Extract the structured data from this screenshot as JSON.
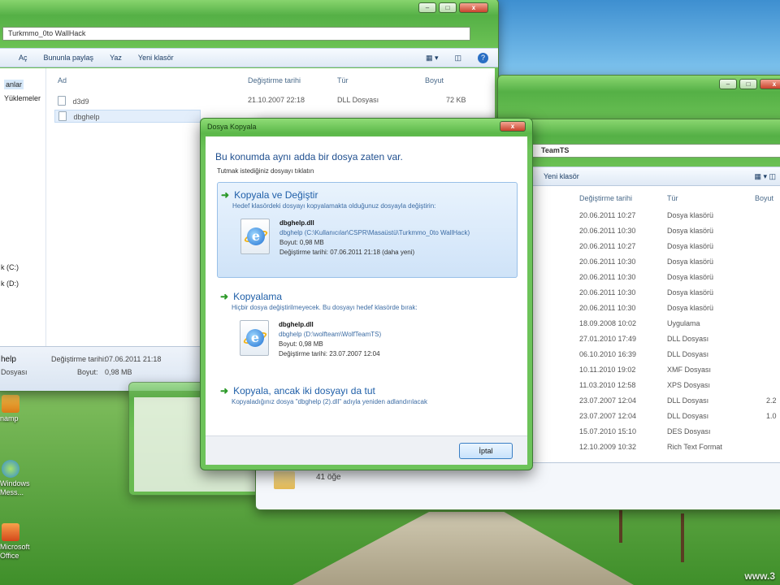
{
  "desktop": {
    "icons": [
      "namp",
      "Windows Mess...",
      "Microsoft Office"
    ],
    "watermark": "www.3"
  },
  "back_window": {
    "breadcrumb": "Turkmmo_0to WallHack",
    "toolbar": [
      "Aç",
      "Bununla paylaş",
      "Yaz",
      "Yeni klasör"
    ],
    "nav": [
      "anlar",
      "Yüklemeler",
      "k (C:)",
      "k (D:)"
    ],
    "columns": [
      "Ad",
      "Değiştirme tarihi",
      "Tür",
      "Boyut"
    ],
    "files": [
      {
        "name": "d3d9",
        "date": "21.10.2007 22:18",
        "type": "DLL Dosyası",
        "size": "72 KB"
      },
      {
        "name": "dbghelp",
        "date": "",
        "type": "",
        "size": ""
      }
    ],
    "details": {
      "name": "help",
      "type": "Dosyası",
      "date_label": "Değiştirme tarihi:",
      "date": "07.06.2011 21:18",
      "size_label": "Boyut:",
      "size": "0,98 MB"
    }
  },
  "right_window": {
    "breadcrumb": "TeamTS",
    "toolbar": [
      "Yeni klasör"
    ],
    "columns": [
      "Değiştirme tarihi",
      "Tür",
      "Boyut"
    ],
    "rows": [
      {
        "date": "20.06.2011 10:27",
        "type": "Dosya klasörü",
        "size": ""
      },
      {
        "date": "20.06.2011 10:30",
        "type": "Dosya klasörü",
        "size": ""
      },
      {
        "date": "20.06.2011 10:27",
        "type": "Dosya klasörü",
        "size": ""
      },
      {
        "date": "20.06.2011 10:30",
        "type": "Dosya klasörü",
        "size": ""
      },
      {
        "date": "20.06.2011 10:30",
        "type": "Dosya klasörü",
        "size": ""
      },
      {
        "date": "20.06.2011 10:30",
        "type": "Dosya klasörü",
        "size": ""
      },
      {
        "date": "20.06.2011 10:30",
        "type": "Dosya klasörü",
        "size": ""
      },
      {
        "date": "18.09.2008 10:02",
        "type": "Uygulama",
        "size": ""
      },
      {
        "date": "27.01.2010 17:49",
        "type": "DLL Dosyası",
        "size": ""
      },
      {
        "date": "06.10.2010 16:39",
        "type": "DLL Dosyası",
        "size": ""
      },
      {
        "date": "10.11.2010 19:02",
        "type": "XMF Dosyası",
        "size": ""
      },
      {
        "date": "11.03.2010 12:58",
        "type": "XPS Dosyası",
        "size": ""
      },
      {
        "date": "23.07.2007 12:04",
        "type": "DLL Dosyası",
        "size": "2.2"
      },
      {
        "date": "23.07.2007 12:04",
        "type": "DLL Dosyası",
        "size": "1.0"
      },
      {
        "date": "15.07.2010 15:10",
        "type": "DES Dosyası",
        "size": ""
      },
      {
        "date": "12.10.2009 10:32",
        "type": "Rich Text Format",
        "size": ""
      }
    ],
    "item_count": "41 öğe"
  },
  "dialog": {
    "title": "Dosya Kopyala",
    "close": "x",
    "heading": "Bu konumda aynı adda bir dosya zaten var.",
    "subheading": "Tutmak istediğiniz dosyayı tıklatın",
    "option1": {
      "title": "Kopyala ve Değiştir",
      "desc": "Hedef klasördeki dosyayı kopyalamakta olduğunuz dosyayla değiştirin:",
      "file_name": "dbghelp.dll",
      "file_path": "dbghelp (C:\\Kullanıcılar\\CSPR\\Masaüstü\\Turkmmo_0to WallHack)",
      "size": "Boyut: 0,98 MB",
      "date": "Değiştirme tarihi: 07.06.2011 21:18 (daha yeni)"
    },
    "option2": {
      "title": "Kopyalama",
      "desc": "Hiçbir dosya değiştirilmeyecek. Bu dosyayı hedef klasörde bırak:",
      "file_name": "dbghelp.dll",
      "file_path": "dbghelp (D:\\wolfteam\\WolfTeamTS)",
      "size": "Boyut: 0,98 MB",
      "date": "Değiştirme tarihi: 23.07.2007 12:04"
    },
    "option3": {
      "title": "Kopyala, ancak iki dosyayı da tut",
      "desc": "Kopyaladığınız dosya \"dbghelp (2).dll\" adıyla yeniden adlandırılacak"
    },
    "cancel": "İptal"
  },
  "colors": {
    "accent_green": "#5cb84a",
    "link_blue": "#1f5fa8",
    "arrow_green": "#2d9a2a"
  }
}
